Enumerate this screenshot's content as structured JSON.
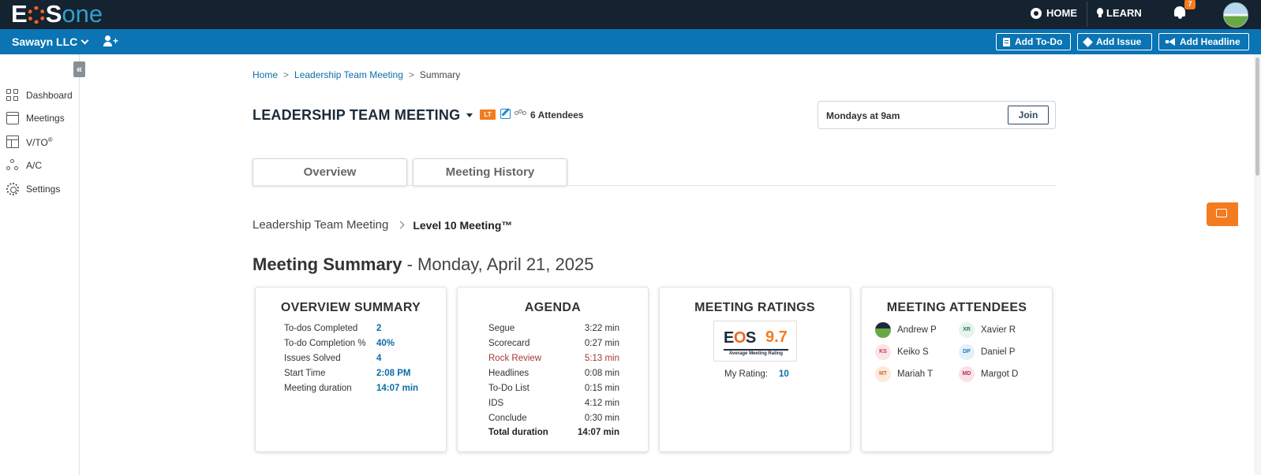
{
  "header": {
    "logo": {
      "e": "E",
      "s": "S",
      "one": "one"
    },
    "nav": {
      "home": "HOME",
      "learn": "LEARN"
    },
    "notifications_count": "7"
  },
  "subheader": {
    "org_name": "Sawayn LLC",
    "buttons": {
      "add_todo": "Add To-Do",
      "add_issue": "Add Issue",
      "add_headline": "Add Headline"
    }
  },
  "sidebar": {
    "collapse_glyph": "«",
    "items": [
      {
        "label": "Dashboard"
      },
      {
        "label": "Meetings"
      },
      {
        "label": "V/TO",
        "sup": "®"
      },
      {
        "label": "A/C"
      },
      {
        "label": "Settings"
      }
    ]
  },
  "breadcrumb": {
    "home": "Home",
    "meeting": "Leadership Team Meeting",
    "current": "Summary",
    "sep": ">"
  },
  "meeting": {
    "title": "LEADERSHIP TEAM MEETING",
    "badge": "LT",
    "attendees": "6 Attendees",
    "schedule": "Mondays at 9am",
    "join_label": "Join"
  },
  "tabs": [
    {
      "label": "Overview"
    },
    {
      "label": "Meeting History"
    }
  ],
  "sub_breadcrumb": {
    "parent": "Leadership Team Meeting",
    "current": "Level 10 Meeting™"
  },
  "summary_heading": {
    "bold": "Meeting Summary",
    "date": " - Monday, April 21, 2025"
  },
  "overview_summary": {
    "title": "OVERVIEW SUMMARY",
    "rows": [
      {
        "label": "To-dos Completed",
        "value": "2"
      },
      {
        "label": "To-do Completion %",
        "value": "40%"
      },
      {
        "label": "Issues Solved",
        "value": "4"
      },
      {
        "label": "Start Time",
        "value": "2:08 PM"
      },
      {
        "label": "Meeting duration",
        "value": "14:07 min"
      }
    ]
  },
  "agenda": {
    "title": "AGENDA",
    "rows": [
      {
        "label": "Segue",
        "value": "3:22 min"
      },
      {
        "label": "Scorecard",
        "value": "0:27 min"
      },
      {
        "label": "Rock Review",
        "value": "5:13 min"
      },
      {
        "label": "Headlines",
        "value": "0:08 min"
      },
      {
        "label": "To-Do List",
        "value": "0:15 min"
      },
      {
        "label": "IDS",
        "value": "4:12 min"
      },
      {
        "label": "Conclude",
        "value": "0:30 min"
      }
    ],
    "total": {
      "label": "Total duration",
      "value": "14:07 min"
    }
  },
  "ratings": {
    "title": "MEETING RATINGS",
    "logo_e": "E",
    "logo_o": "O",
    "logo_s": "S",
    "average_value": "9.7",
    "average_caption": "Average Meeting Rating",
    "my_rating_label": "My Rating:",
    "my_rating_value": "10"
  },
  "attendees_card": {
    "title": "MEETING ATTENDEES",
    "people": [
      {
        "initials": "",
        "name": "Andrew P"
      },
      {
        "initials": "XR",
        "name": "Xavier R"
      },
      {
        "initials": "KS",
        "name": "Keiko S"
      },
      {
        "initials": "DP",
        "name": "Daniel P"
      },
      {
        "initials": "MT",
        "name": "Mariah T"
      },
      {
        "initials": "MD",
        "name": "Margot D"
      }
    ]
  },
  "colors": {
    "top_bar": "#15222f",
    "sub_bar": "#0a74b4",
    "accent_orange": "#f47b20",
    "link_blue": "#0a6ea8",
    "rock_review_red": "#a33a3a"
  }
}
